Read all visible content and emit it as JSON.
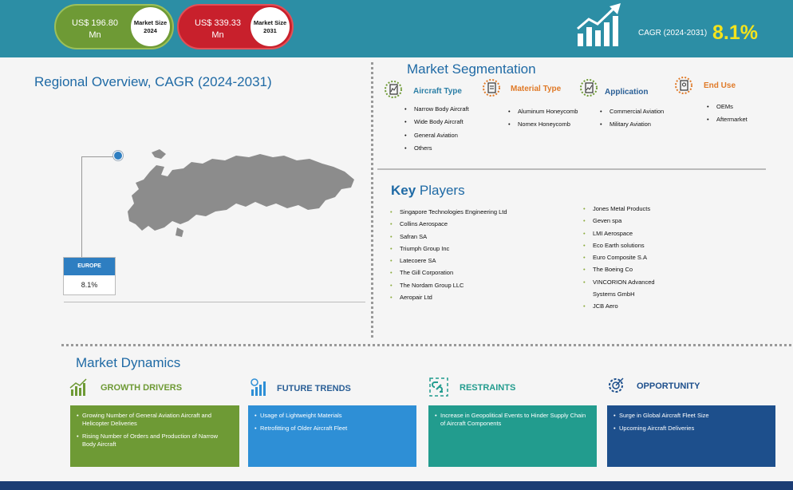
{
  "header": {
    "size_2024": {
      "value": "US$ 196.80 Mn",
      "label_line1": "Market Size",
      "label_line2": "2024"
    },
    "size_2031": {
      "value": "US$ 339.33 Mn",
      "label_line1": "Market Size",
      "label_line2": "2031"
    },
    "cagr_label": "CAGR (2024-2031)",
    "cagr_value": "8.1%"
  },
  "regional": {
    "title": "Regional Overview, CAGR (2024-2031)",
    "region_name": "EUROPE",
    "region_value": "8.1%"
  },
  "segmentation": {
    "title": "Market Segmentation",
    "groups": [
      {
        "heading": "Aircraft Type",
        "color": "#2c7fa6",
        "items": [
          "Narrow Body Aircraft",
          "Wide Body Aircraft",
          "General Aviation",
          "Others"
        ]
      },
      {
        "heading": "Material Type",
        "color": "#e07a28",
        "items": [
          "Aluminum Honeycomb",
          "Nomex Honeycomb"
        ]
      },
      {
        "heading": "Application",
        "color": "#2a5f96",
        "items": [
          "Commercial Aviation",
          "Military Aviation"
        ]
      },
      {
        "heading": "End Use",
        "color": "#e07a28",
        "items": [
          "OEMs",
          "Aftermarket"
        ]
      }
    ]
  },
  "key_players": {
    "title_key": "Key",
    "title_rest": " Players",
    "col1": [
      "Singapore Technologies Engineering Ltd",
      "Collins Aerospace",
      "Safran SA",
      "Triumph Group Inc",
      "Latecoere SA",
      "The Gill Corporation",
      "The Nordam Group LLC",
      "Aeropair Ltd"
    ],
    "col2": [
      "Jones Metal Products",
      "Geven spa",
      "LMI Aerospace",
      "Eco Earth solutions",
      "Euro Composite S.A",
      "The Boeing Co",
      "VINCORION Advanced Systems GmbH",
      "JCB Aero"
    ]
  },
  "dynamics": {
    "title": "Market Dynamics",
    "cards": [
      {
        "heading": "GROWTH DRIVERS",
        "color": "#6e9a35",
        "items": [
          "Growing Number of General Aviation Aircraft and Helicopter Deliveries",
          "Rising Number of Orders and Production of Narrow Body Aircraft"
        ]
      },
      {
        "heading": "FUTURE TRENDS",
        "color": "#2e8fd6",
        "items": [
          "Usage of Lightweight Materials",
          "Retrofitting of Older Aircraft Fleet"
        ]
      },
      {
        "heading": "RESTRAINTS",
        "color": "#229c8e",
        "items": [
          "Increase in Geopolitical Events to Hinder Supply Chain of Aircraft Components"
        ]
      },
      {
        "heading": "OPPORTUNITY",
        "color": "#1d4f8c",
        "items": [
          "Surge in Global Aircraft Fleet Size",
          "Upcoming Aircraft Deliveries"
        ]
      }
    ]
  }
}
